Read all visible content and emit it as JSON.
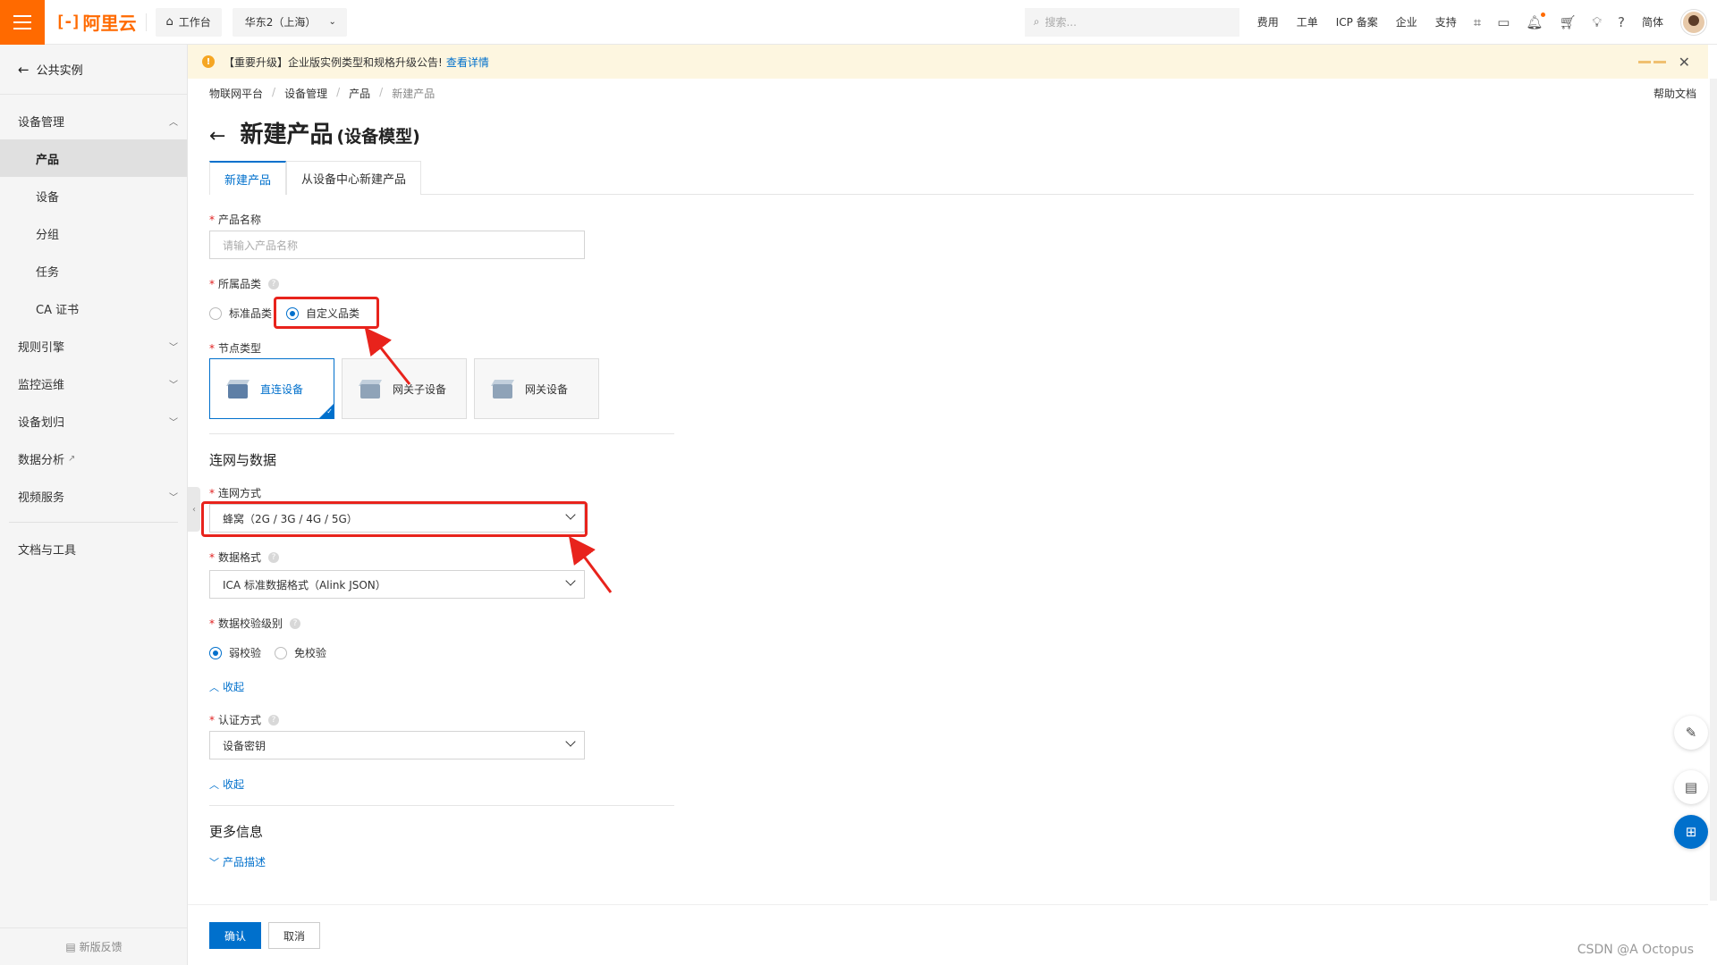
{
  "topbar": {
    "logo_text": "阿里云",
    "workbench": "工作台",
    "region": "华东2（上海）",
    "search_placeholder": "搜索...",
    "links": [
      "费用",
      "工单",
      "ICP 备案",
      "企业",
      "支持"
    ],
    "lang": "简体",
    "accent_color": "#ff6a00"
  },
  "sidebar": {
    "back_label": "公共实例",
    "group_device": "设备管理",
    "items": [
      "产品",
      "设备",
      "分组",
      "任务",
      "CA 证书"
    ],
    "groups": [
      "规则引擎",
      "监控运维",
      "设备划归",
      "数据分析",
      "视频服务"
    ],
    "docs": "文档与工具",
    "feedback": "新版反馈"
  },
  "notice": {
    "text": "【重要升级】企业版实例类型和规格升级公告!",
    "link": "查看详情"
  },
  "breadcrumb": [
    "物联网平台",
    "设备管理",
    "产品",
    "新建产品"
  ],
  "help_doc": "帮助文档",
  "page": {
    "title": "新建产品",
    "subtitle": "(设备模型)"
  },
  "tabs": [
    "新建产品",
    "从设备中心新建产品"
  ],
  "form": {
    "product_name_label": "产品名称",
    "product_name_placeholder": "请输入产品名称",
    "category_label": "所属品类",
    "category_options": [
      "标准品类",
      "自定义品类"
    ],
    "node_type_label": "节点类型",
    "node_types": [
      "直连设备",
      "网关子设备",
      "网关设备"
    ],
    "section_network": "连网与数据",
    "network_label": "连网方式",
    "network_value": "蜂窝（2G / 3G / 4G / 5G）",
    "data_format_label": "数据格式",
    "data_format_value": "ICA 标准数据格式（Alink JSON）",
    "validation_label": "数据校验级别",
    "validation_options": [
      "弱校验",
      "免校验"
    ],
    "collapse_label": "收起",
    "auth_label": "认证方式",
    "auth_value": "设备密钥",
    "section_more": "更多信息",
    "product_desc_link": "产品描述"
  },
  "footer": {
    "confirm": "确认",
    "cancel": "取消",
    "watermark": "CSDN @A   Octopus"
  }
}
